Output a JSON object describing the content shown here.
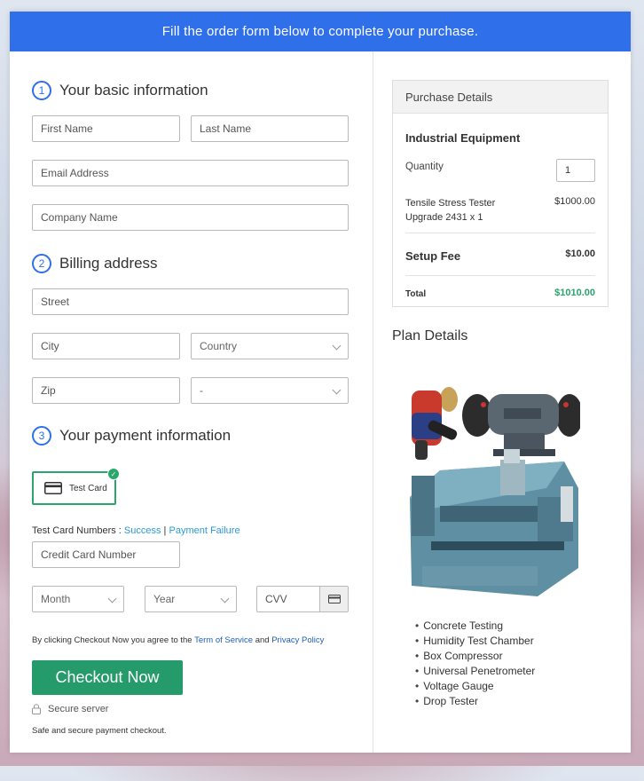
{
  "banner": {
    "text": "Fill the order form below to complete your purchase."
  },
  "sections": {
    "basic": {
      "num": "1",
      "title": "Your basic information"
    },
    "billing": {
      "num": "2",
      "title": "Billing address"
    },
    "payment": {
      "num": "3",
      "title": "Your payment information"
    }
  },
  "fields": {
    "first_name": "First Name",
    "last_name": "Last Name",
    "email": "Email Address",
    "company": "Company Name",
    "street": "Street",
    "city": "City",
    "country": "Country",
    "zip": "Zip",
    "state": "-",
    "card_number": "Credit Card Number",
    "month": "Month",
    "year": "Year",
    "cvv": "CVV"
  },
  "payment": {
    "test_card_label": "Test Card",
    "numbers_label": "Test Card Numbers : ",
    "success": "Success",
    "separator": " | ",
    "failure": "Payment Failure"
  },
  "terms": {
    "prefix": "By clicking Checkout Now you agree to the ",
    "tos": "Term of Service",
    "and": " and ",
    "privacy": "Privacy Policy"
  },
  "checkout": {
    "button": "Checkout Now",
    "secure": "Secure server",
    "safe": "Safe and secure payment checkout."
  },
  "purchase": {
    "header": "Purchase Details",
    "product": "Industrial Equipment",
    "quantity_label": "Quantity",
    "quantity_value": "1",
    "item_line1": "Tensile Stress Tester",
    "item_line2": "Upgrade 2431 x 1",
    "item_price": "$1000.00",
    "setup_label": "Setup Fee",
    "setup_price": "$10.00",
    "total_label": "Total",
    "total_price": "$1010.00",
    "total_color": "#2aa56b"
  },
  "plan": {
    "title": "Plan Details",
    "items": [
      "Concrete Testing",
      "Humidity Test Chamber",
      "Box Compressor",
      "Universal Penetrometer",
      "Voltage Gauge",
      "Drop Tester"
    ]
  },
  "colors": {
    "primary": "#2f6fea",
    "accent_green": "#259a6a"
  }
}
